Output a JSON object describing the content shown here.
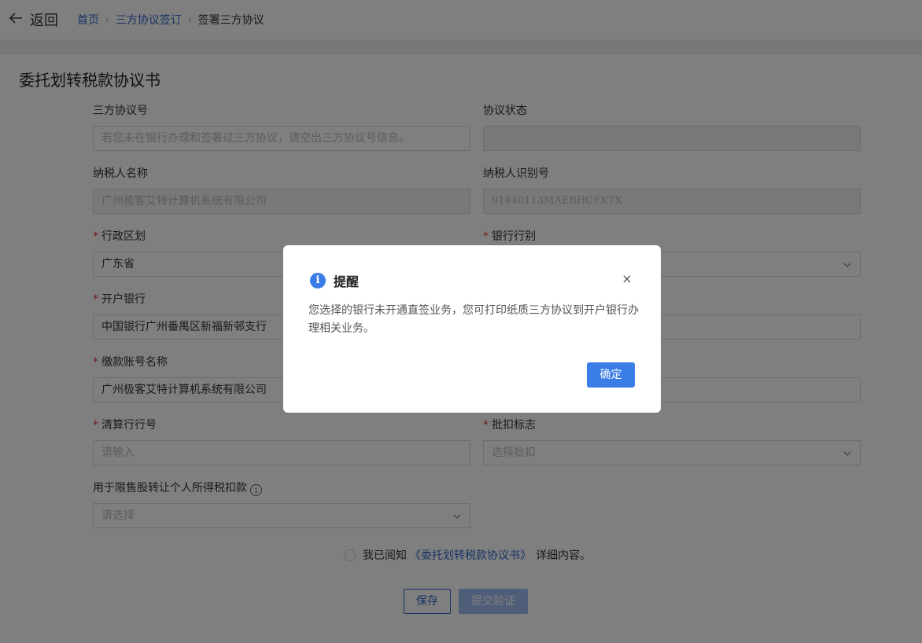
{
  "topbar": {
    "back_label": "返回",
    "breadcrumb": [
      "首页",
      "三方协议签订",
      "签署三方协议"
    ]
  },
  "form": {
    "title": "委托划转税款协议书",
    "agreement_no": {
      "label": "三方协议号",
      "placeholder": "若您未在银行办理和签署过三方协议，请空出三方协议号信息。"
    },
    "agreement_status": {
      "label": "协议状态",
      "value": ""
    },
    "taxpayer_name": {
      "label": "纳税人名称",
      "value": "广州极客艾特计算机系统有限公司"
    },
    "taxpayer_id": {
      "label": "纳税人识别号",
      "value": "91440113MAEBHCFK7X"
    },
    "region": {
      "label": "行政区划",
      "value": "广东省"
    },
    "bank_type": {
      "label": "银行行别",
      "value": ""
    },
    "bank": {
      "label": "开户银行",
      "value": "中国银行广州番禺区新福新邨支行"
    },
    "bank_account": {
      "label": "",
      "value": ""
    },
    "account_name": {
      "label": "缴款账号名称",
      "value": "广州极客艾特计算机系统有限公司"
    },
    "account_right": {
      "label": "",
      "value": ""
    },
    "clearing_no": {
      "label": "清算行行号",
      "placeholder": "请输入"
    },
    "batch_flag": {
      "label": "批扣标志",
      "placeholder": "选择批扣"
    },
    "restricted_shares": {
      "label": "用于限售股转让个人所得税扣款",
      "placeholder": "请选择"
    },
    "agree": {
      "prefix": "我已阅知",
      "link": "《委托划转税款协议书》",
      "suffix": "详细内容。"
    },
    "save_label": "保存",
    "submit_label": "提交验证"
  },
  "dialog": {
    "title": "提醒",
    "message": "您选择的银行未开通直签业务，您可打印纸质三方协议到开户银行办理相关业务。",
    "ok_label": "确定",
    "close_glyph": "×"
  },
  "icons": {
    "back": "arrow-left-icon",
    "info": "info-icon",
    "chevron": "chevron-down-icon",
    "close": "close-icon"
  },
  "colors": {
    "link": "#2f66c9",
    "primary": "#3b7de6",
    "required": "#e23a3a"
  }
}
